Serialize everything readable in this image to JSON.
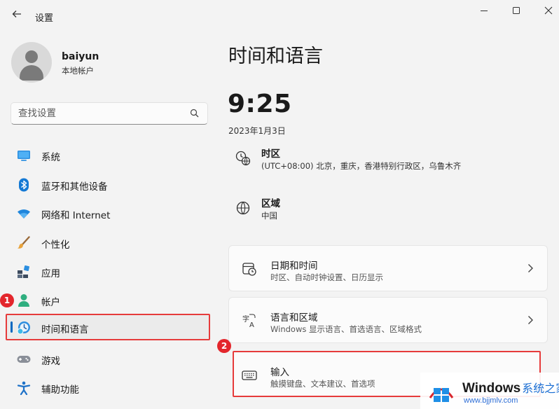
{
  "window": {
    "title": "设置"
  },
  "user": {
    "name": "baiyun",
    "account_type": "本地帐户"
  },
  "search": {
    "placeholder": "查找设置"
  },
  "sidebar": {
    "items": [
      {
        "label": "系统",
        "icon": "monitor-icon"
      },
      {
        "label": "蓝牙和其他设备",
        "icon": "bluetooth-icon"
      },
      {
        "label": "网络和 Internet",
        "icon": "wifi-icon"
      },
      {
        "label": "个性化",
        "icon": "brush-icon"
      },
      {
        "label": "应用",
        "icon": "apps-icon"
      },
      {
        "label": "帐户",
        "icon": "person-icon"
      },
      {
        "label": "时间和语言",
        "icon": "clock-globe-icon",
        "active": true
      },
      {
        "label": "游戏",
        "icon": "gamepad-icon"
      },
      {
        "label": "辅助功能",
        "icon": "accessibility-icon"
      }
    ]
  },
  "annotations": {
    "badge1": "1",
    "badge2": "2"
  },
  "main": {
    "title": "时间和语言",
    "time": "9:25",
    "date": "2023年1月3日",
    "timezone": {
      "label": "时区",
      "value": "(UTC+08:00) 北京，重庆，香港特别行政区，乌鲁木齐",
      "icon": "timezone-icon"
    },
    "region": {
      "label": "区域",
      "value": "中国",
      "icon": "globe-icon"
    },
    "cards": [
      {
        "title": "日期和时间",
        "subtitle": "时区、自动时钟设置、日历显示",
        "icon": "calendar-clock-icon"
      },
      {
        "title": "语言和区域",
        "subtitle": "Windows 显示语言、首选语言、区域格式",
        "icon": "language-icon"
      },
      {
        "title": "输入",
        "subtitle": "触摸键盘、文本建议、首选项",
        "icon": "keyboard-icon"
      }
    ]
  },
  "watermark": {
    "brand": "Windows",
    "brand_cn": "系统之家",
    "url": "www.bjjmlv.com"
  },
  "colors": {
    "accent": "#0067c0",
    "highlight_border": "#e63b3b",
    "badge": "#e3262c",
    "background": "#f3f3f3"
  }
}
